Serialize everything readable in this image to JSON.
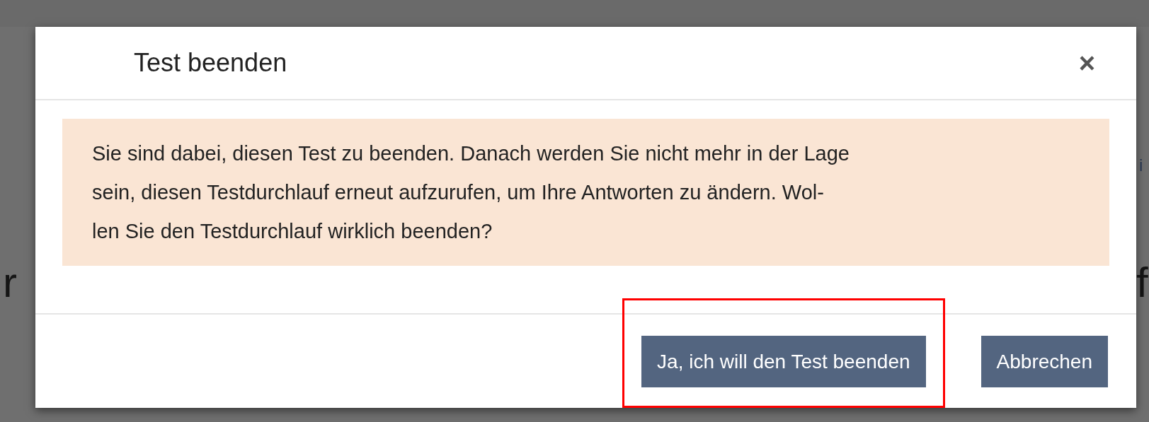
{
  "background_page": {
    "left_fragment": "r",
    "right_fragment": "f",
    "right_link_fragment": "i"
  },
  "dialog": {
    "title": "Test beenden",
    "close_label": "×",
    "alert_lines": [
      "Sie sind dabei, diesen Test zu beenden. Danach werden Sie nicht mehr in der Lage",
      "sein, diesen Testdurchlauf erneut aufzurufen, um Ihre Antworten zu ändern. Wol-",
      "len Sie den Testdurchlauf wirklich beenden?"
    ],
    "buttons": [
      {
        "label": "Ja, ich will den Test beenden",
        "highlighted": true
      },
      {
        "label": "Abbrechen",
        "highlighted": false
      }
    ]
  }
}
